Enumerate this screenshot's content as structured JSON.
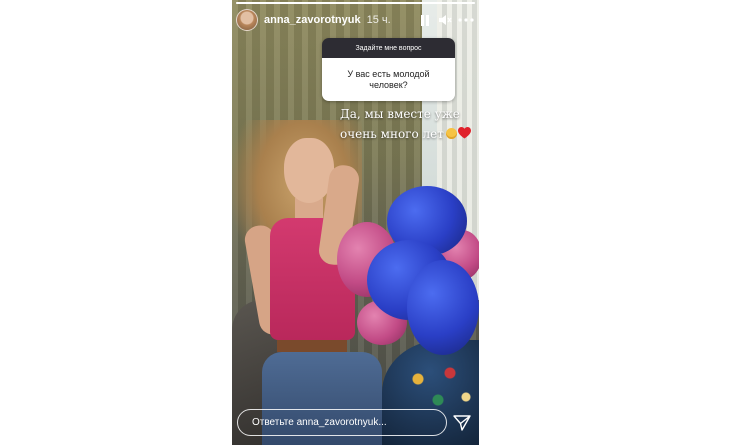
{
  "story": {
    "progress": 1.0,
    "username": "anna_zavorotnyuk",
    "time_ago": "15 ч.",
    "controls": {
      "pause_icon": "pause-icon",
      "mute_icon": "speaker-muted-icon",
      "more_icon": "more-dots-icon"
    }
  },
  "question_sticker": {
    "header": "Задайте мне вопрос",
    "question": "У вас есть молодой человек?"
  },
  "answer_text": {
    "line1": "Да, мы вместе уже",
    "line2": "очень много лет"
  },
  "reply_bar": {
    "placeholder": "Ответьте anna_zavorotnyuk...",
    "send_icon": "paper-plane-icon"
  },
  "colors": {
    "top_pink": "#d33a6f",
    "hydrangea_blue": "#2a3fc6",
    "hydrangea_pink": "#c24b86",
    "sticker_header": "#2d2c33"
  }
}
